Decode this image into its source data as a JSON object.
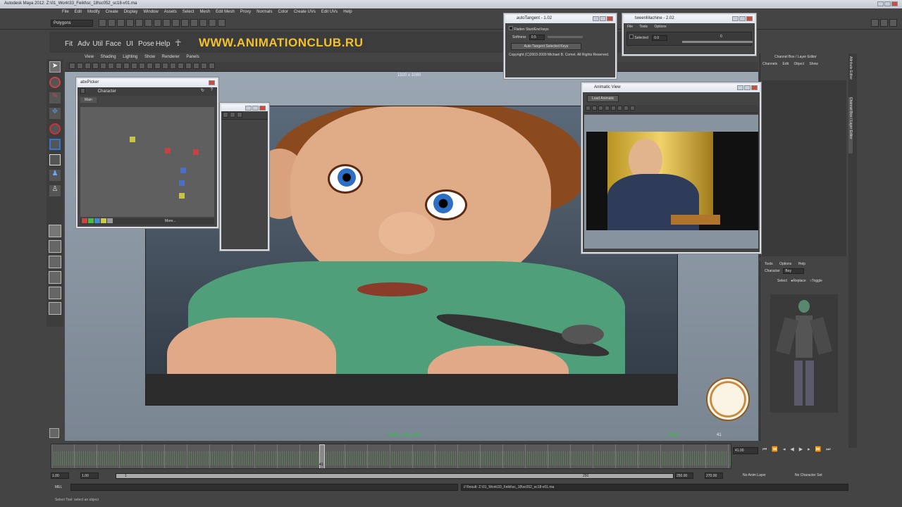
{
  "app": {
    "title": "Autodesk Maya 2012: Z:\\01_Work\\33_Feikt\\sc_18\\sc052_sc18-v01.ma"
  },
  "menubar": [
    "File",
    "Edit",
    "Modify",
    "Create",
    "Display",
    "Window",
    "Assets",
    "Select",
    "Mesh",
    "Edit Mesh",
    "Proxy",
    "Normals",
    "Color",
    "Create UVs",
    "Edit UVs",
    "Help"
  ],
  "mode_dropdown": "Polygons",
  "shelf": {
    "buttons": [
      "Fit",
      "Adv",
      "Util",
      "Face",
      "UI",
      "Pose",
      "Help"
    ],
    "watermark": "WWW.ANIMATIONCLUB.RU"
  },
  "panel_menu": [
    "View",
    "Shading",
    "Lighting",
    "Show",
    "Renderer",
    "Panels"
  ],
  "viewport": {
    "resolution": "1920 x 1080",
    "camera": "sc052_sc18_cam",
    "fps": "24 fps"
  },
  "autotangent": {
    "title": "autoTangent - 1.02",
    "flatten_label": "Flatten Start/End keys",
    "softness_label": "Softness",
    "softness_value": "0.5",
    "button": "Auto Tangent Selected Keys",
    "copyright": "Copyright (C)2003-2009 Michael B. Comet. All Rights Reserved."
  },
  "tweenmachine": {
    "title": "tweenMachine - 2.02",
    "menu": [
      "File",
      "Tools",
      "Options"
    ],
    "selected_label": "Selected",
    "value": "0.0",
    "right_value": "0"
  },
  "abxpicker": {
    "title": "abxPicker",
    "dropdown": "Character",
    "tab": "Main",
    "more": "More..."
  },
  "animatic": {
    "title": "Animatic View",
    "button": "Load Animatic"
  },
  "channelbox": {
    "header": "Channel Box / Layer Editor",
    "menu": [
      "Channels",
      "Edit",
      "Object",
      "Show"
    ],
    "side_tabs": [
      "Attribute Editor",
      "Channel Box / Layer Editor"
    ]
  },
  "charpanel": {
    "menu": [
      "Tools",
      "Options",
      "Help"
    ],
    "character_label": "Character",
    "character_value": "Boy",
    "select_label": "Select",
    "replace_label": "Replace",
    "toggle_label": "Toggle"
  },
  "timeline": {
    "range_start": "1.00",
    "range_start2": "1.00",
    "frame_marker": "1",
    "range_end": "250",
    "end1": "250.00",
    "end2": "270.00",
    "current_frame": "41.00",
    "anim_layer": "No Anim Layer",
    "character_set": "No Character Set",
    "current_tick": "41"
  },
  "commandline": {
    "label": "MEL",
    "result": "// Result: Z:\\01_Work\\33_Feikt\\sc_18\\sc052_sc18-v01.ma"
  },
  "helpline": "Select Tool: select an object",
  "colors": {
    "accent": "#f2c22e",
    "panel": "#444444",
    "titlebar": "#e5e9ef",
    "ui_dark": "#2b2b2b"
  }
}
